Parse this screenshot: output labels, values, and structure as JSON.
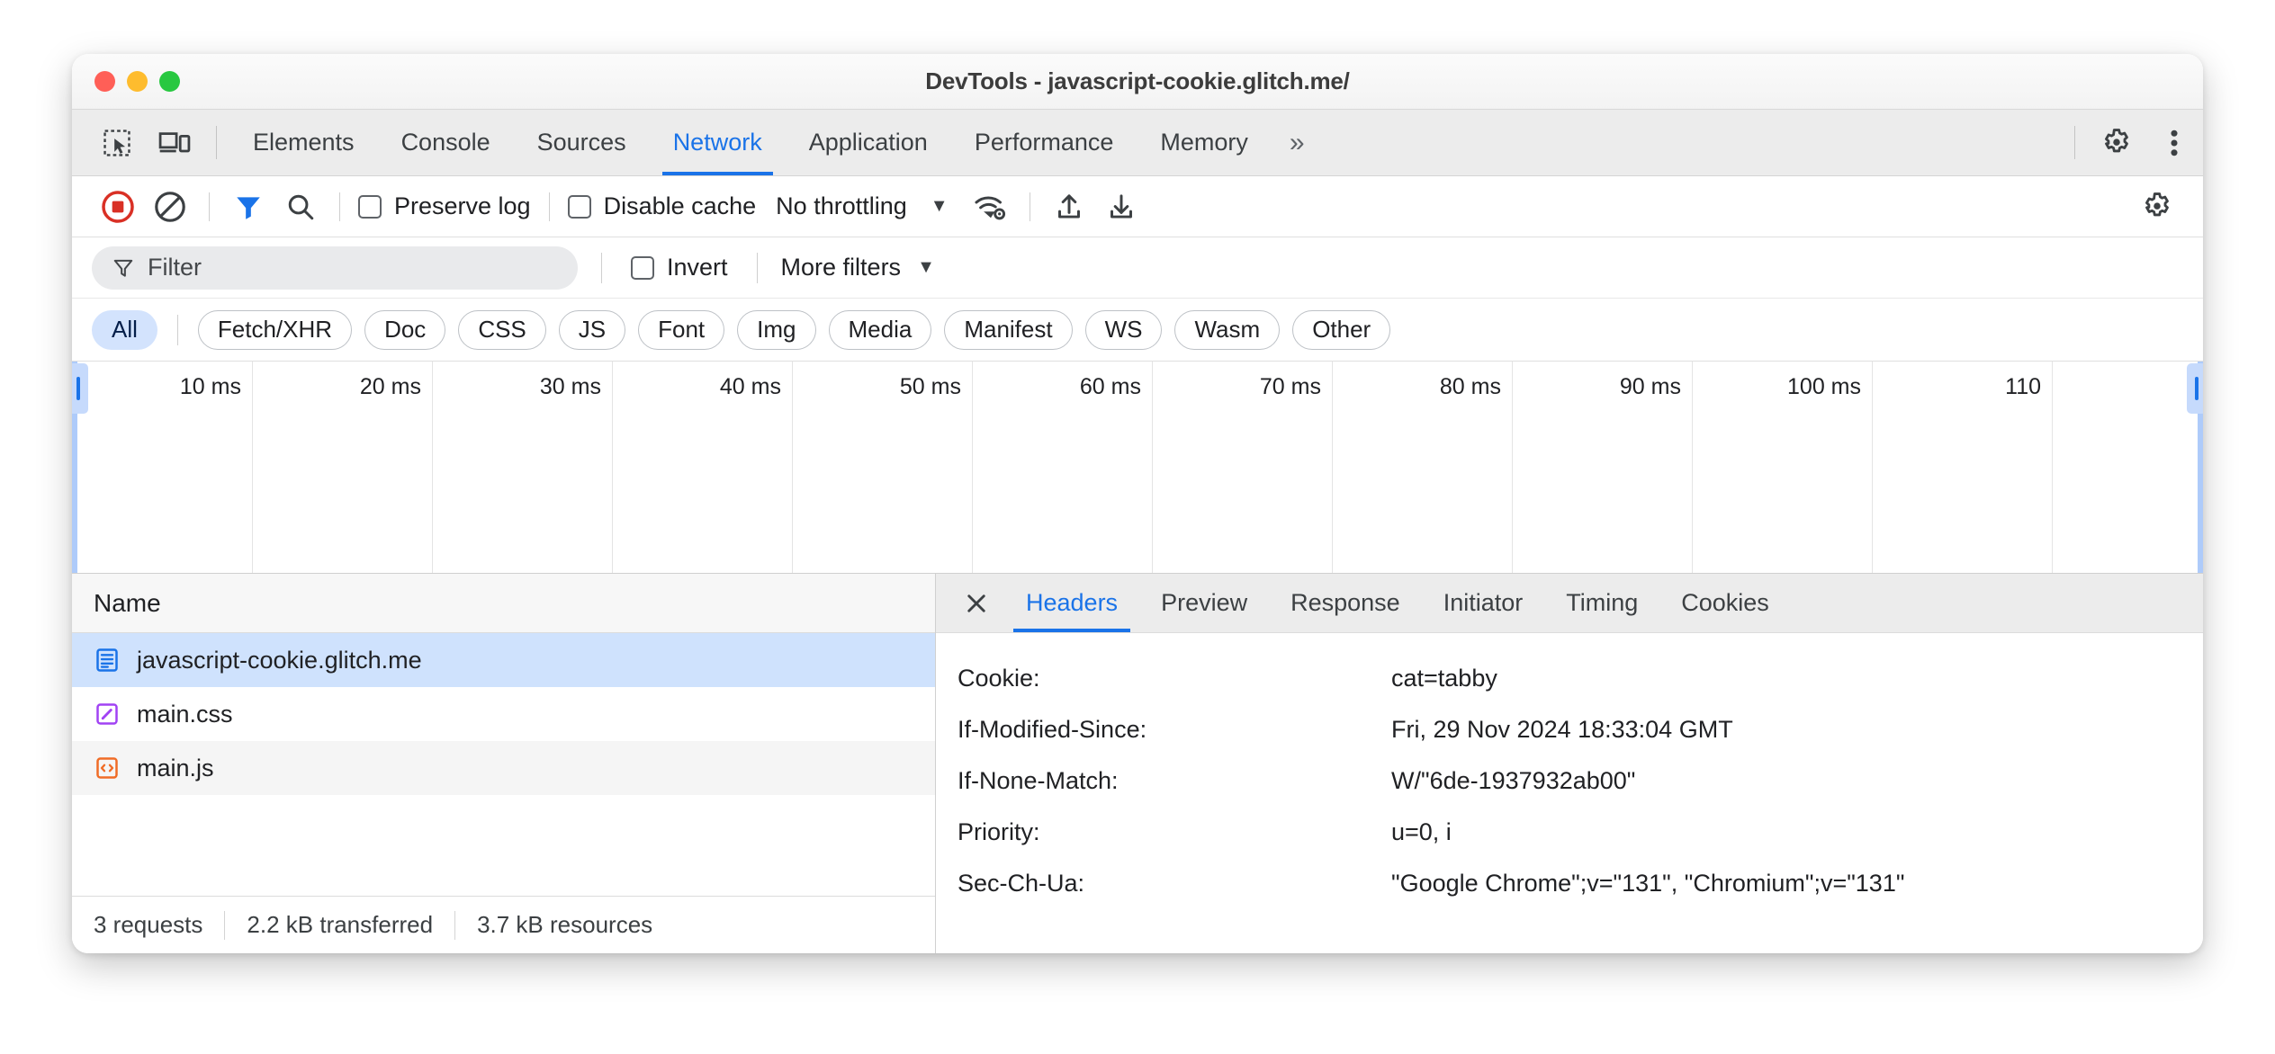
{
  "window": {
    "title": "DevTools - javascript-cookie.glitch.me/"
  },
  "main_tabs": {
    "inspect_icon": "inspect-element-icon",
    "device_icon": "device-toolbar-icon",
    "items": [
      {
        "label": "Elements",
        "active": false
      },
      {
        "label": "Console",
        "active": false
      },
      {
        "label": "Sources",
        "active": false
      },
      {
        "label": "Network",
        "active": true
      },
      {
        "label": "Application",
        "active": false
      },
      {
        "label": "Performance",
        "active": false
      },
      {
        "label": "Memory",
        "active": false
      }
    ],
    "overflow": "»",
    "settings_icon": "gear-icon",
    "more_icon": "kebab-menu-icon"
  },
  "network_toolbar": {
    "record_icon": "record-stop-icon",
    "clear_icon": "clear-icon",
    "filter_icon": "funnel-filter-icon",
    "search_icon": "search-icon",
    "preserve_log": {
      "label": "Preserve log",
      "checked": false
    },
    "disable_cache": {
      "label": "Disable cache",
      "checked": false
    },
    "throttling": {
      "value": "No throttling",
      "caret": "▼"
    },
    "network_conditions_icon": "wifi-settings-icon",
    "import_icon": "import-har-icon",
    "export_icon": "export-har-icon",
    "settings_icon": "network-settings-gear-icon"
  },
  "filter_row": {
    "placeholder": "Filter",
    "invert": {
      "label": "Invert",
      "checked": false
    },
    "more_filters": {
      "label": "More filters",
      "caret": "▼"
    }
  },
  "type_chips": [
    {
      "label": "All",
      "selected": true
    },
    {
      "label": "Fetch/XHR",
      "selected": false
    },
    {
      "label": "Doc",
      "selected": false
    },
    {
      "label": "CSS",
      "selected": false
    },
    {
      "label": "JS",
      "selected": false
    },
    {
      "label": "Font",
      "selected": false
    },
    {
      "label": "Img",
      "selected": false
    },
    {
      "label": "Media",
      "selected": false
    },
    {
      "label": "Manifest",
      "selected": false
    },
    {
      "label": "WS",
      "selected": false
    },
    {
      "label": "Wasm",
      "selected": false
    },
    {
      "label": "Other",
      "selected": false
    }
  ],
  "timeline": {
    "ticks": [
      "10 ms",
      "20 ms",
      "30 ms",
      "40 ms",
      "50 ms",
      "60 ms",
      "70 ms",
      "80 ms",
      "90 ms",
      "100 ms",
      "110"
    ],
    "unit": "ms"
  },
  "request_list": {
    "column_header": "Name",
    "rows": [
      {
        "name": "javascript-cookie.glitch.me",
        "icon": "document-icon",
        "selected": true
      },
      {
        "name": "main.css",
        "icon": "stylesheet-icon",
        "selected": false
      },
      {
        "name": "main.js",
        "icon": "script-icon",
        "selected": false
      }
    ],
    "status": {
      "requests": "3 requests",
      "transferred": "2.2 kB transferred",
      "resources": "3.7 kB resources"
    }
  },
  "detail": {
    "close_icon": "close-icon",
    "tabs": [
      {
        "label": "Headers",
        "active": true
      },
      {
        "label": "Preview",
        "active": false
      },
      {
        "label": "Response",
        "active": false
      },
      {
        "label": "Initiator",
        "active": false
      },
      {
        "label": "Timing",
        "active": false
      },
      {
        "label": "Cookies",
        "active": false
      }
    ],
    "headers": [
      {
        "key": "Cookie:",
        "value": "cat=tabby"
      },
      {
        "key": "If-Modified-Since:",
        "value": "Fri, 29 Nov 2024 18:33:04 GMT"
      },
      {
        "key": "If-None-Match:",
        "value": "W/\"6de-1937932ab00\""
      },
      {
        "key": "Priority:",
        "value": "u=0, i"
      },
      {
        "key": "Sec-Ch-Ua:",
        "value": "\"Google Chrome\";v=\"131\", \"Chromium\";v=\"131\""
      }
    ]
  },
  "colors": {
    "accent": "#1a73e8",
    "selected_row": "#cfe2fd",
    "chip_selected": "#d3e3fd",
    "record_red": "#d93025",
    "doc_blue": "#1a73e8",
    "css_purple": "#a142f4",
    "js_orange": "#f29900"
  }
}
